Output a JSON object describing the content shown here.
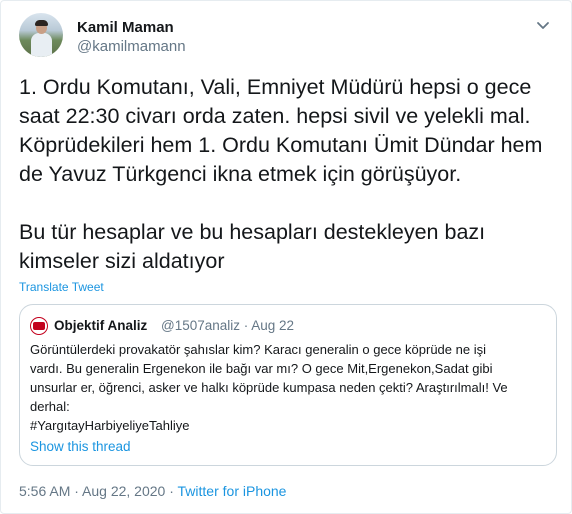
{
  "author": {
    "name": "Kamil Maman",
    "handle": "@kamilmamann"
  },
  "icons": {
    "avatar": "user-avatar-photo",
    "menu": "chevron-down-icon",
    "quoted_avatar": "objektif-analiz-logo"
  },
  "tweet": {
    "text": "1. Ordu Komutanı, Vali, Emniyet Müdürü hepsi o gece\nsaat 22:30 civarı orda zaten. hepsi sivil ve yelekli mal.\nKöprüdekileri hem 1. Ordu Komutanı Ümit Dündar hem\nde Yavuz Türkgenci ikna etmek için görüşüyor.\n\nBu tür hesaplar ve bu hesapları destekleyen bazı\nkimseler sizi aldatıyor",
    "translate_label": "Translate Tweet"
  },
  "quoted": {
    "name": "Objektif Analiz",
    "meta": "@1507analiz · Aug 22",
    "text": "Görüntülerdeki provakatör şahıslar kim? Karacı generalin o gece köprüde ne işi\nvardı. Bu generalin Ergenekon ile bağı var mı? O gece Mit,Ergenekon,Sadat gibi\nunsurlar er, öğrenci, asker ve halkı köprüde kumpasa neden çekti? Araştırılmalı! Ve\nderhal:\n#YargıtayHarbiyeliyeTahliye",
    "show_thread": "Show this thread"
  },
  "footer": {
    "time_date": "5:56 AM · Aug 22, 2020 · ",
    "source": "Twitter for iPhone"
  },
  "colors": {
    "link": "#1b95e0",
    "secondary_text": "#657786",
    "border": "#ccd6dd",
    "text": "#14171a"
  }
}
